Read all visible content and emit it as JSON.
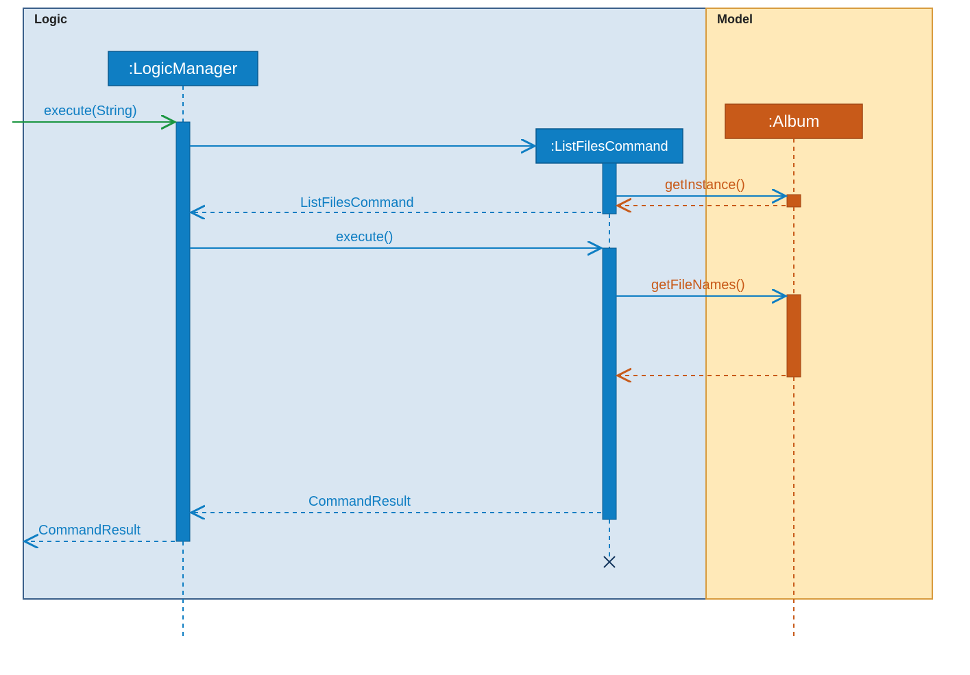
{
  "frames": {
    "logic": {
      "label": "Logic"
    },
    "model": {
      "label": "Model"
    }
  },
  "lifelines": {
    "logicManager": {
      "header": ":LogicManager"
    },
    "listFilesCommand": {
      "header": ":ListFilesCommand"
    },
    "album": {
      "header": ":Album"
    }
  },
  "messages": {
    "executeString": "execute(String)",
    "listFilesCommandReturn": "ListFilesCommand",
    "execute": "execute()",
    "getInstance": "getInstance()",
    "getFileNames": "getFileNames()",
    "commandResultReturn": "CommandResult",
    "commandResultOut": "CommandResult"
  },
  "colors": {
    "logicBlue": "#0f7ec3",
    "logicFrameFill": "#d9e6f2",
    "logicFrameBorder": "#3a5f8a",
    "modelOrange": "#c85a19",
    "modelFrameFill": "#ffe9b8",
    "modelFrameBorder": "#d89b3e",
    "greenArrow": "#1a9641"
  }
}
